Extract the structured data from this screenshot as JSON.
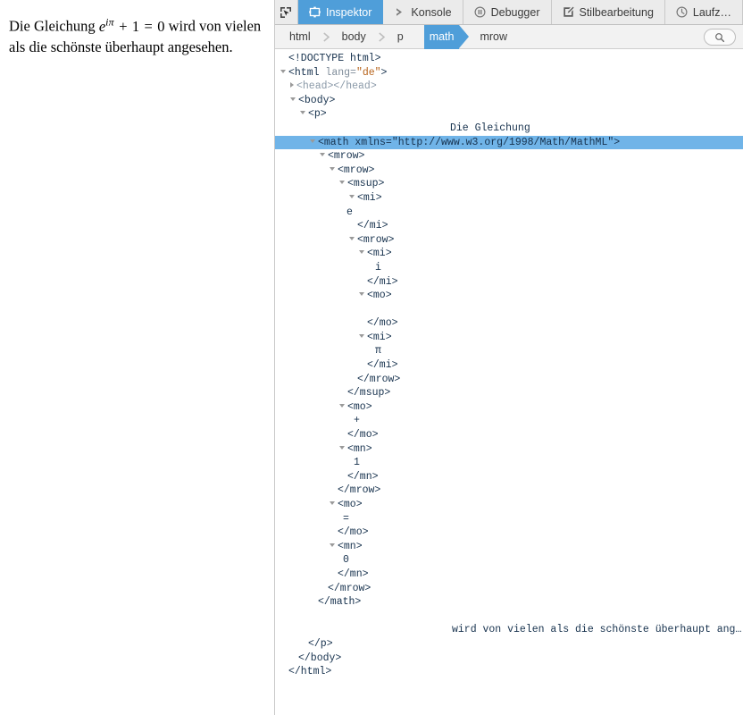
{
  "page": {
    "paragraph_prefix": "Die Gleichung ",
    "math": {
      "base": "e",
      "exponent": "iπ",
      "plus": "+",
      "one": "1",
      "equals": "=",
      "zero": "0"
    },
    "paragraph_suffix": " wird von vielen als die schönste überhaupt angesehen."
  },
  "toolbar": {
    "picker_icon": "node-picker-icon",
    "tabs": [
      {
        "label": "Inspektor",
        "icon": "inspector-icon",
        "active": true
      },
      {
        "label": "Konsole",
        "icon": "console-chevron-icon",
        "active": false
      },
      {
        "label": "Debugger",
        "icon": "debugger-pause-icon",
        "active": false
      },
      {
        "label": "Stilbearbeitung",
        "icon": "style-editor-icon",
        "active": false
      },
      {
        "label": "Laufz…",
        "icon": "performance-clock-icon",
        "active": false
      }
    ],
    "active_tab_color": "#4f9ed9"
  },
  "breadcrumb": {
    "items": [
      {
        "label": "html",
        "selected": false
      },
      {
        "label": "body",
        "selected": false
      },
      {
        "label": "p",
        "selected": false
      },
      {
        "label": "math",
        "selected": true
      },
      {
        "label": "mrow",
        "selected": false
      }
    ],
    "search_icon": "search-icon"
  },
  "markup": {
    "selected_row_color": "#70b4e8",
    "rows": [
      {
        "indent": 0,
        "twisty": "none",
        "type": "doctype",
        "text": "<!DOCTYPE html>"
      },
      {
        "indent": 0,
        "twisty": "open",
        "type": "tag_attr",
        "tag_open": "<html ",
        "attr": "lang=",
        "aval": "\"de\"",
        "tag_close": ">"
      },
      {
        "indent": 1,
        "twisty": "closed",
        "type": "collapsed",
        "text": "<head></head>"
      },
      {
        "indent": 1,
        "twisty": "open",
        "type": "tag",
        "text": "<body>"
      },
      {
        "indent": 2,
        "twisty": "open",
        "type": "tag",
        "text": "<p>"
      },
      {
        "indent": 0,
        "twisty": "none",
        "type": "textnode",
        "text": "Die Gleichung",
        "offset": 196
      },
      {
        "indent": 3,
        "twisty": "open",
        "type": "tag_ns",
        "text": "<math xmlns=\"http://www.w3.org/1998/Math/MathML\">",
        "selected": true
      },
      {
        "indent": 4,
        "twisty": "open",
        "type": "tag",
        "text": "<mrow>"
      },
      {
        "indent": 5,
        "twisty": "open",
        "type": "tag",
        "text": "<mrow>"
      },
      {
        "indent": 6,
        "twisty": "open",
        "type": "tag",
        "text": "<msup>"
      },
      {
        "indent": 7,
        "twisty": "open",
        "type": "tag",
        "text": "<mi>"
      },
      {
        "indent": 0,
        "twisty": "none",
        "type": "textnode",
        "text": "e",
        "offset": 80
      },
      {
        "indent": 7,
        "twisty": "none",
        "type": "tag",
        "text": "</mi>"
      },
      {
        "indent": 7,
        "twisty": "open",
        "type": "tag",
        "text": "<mrow>"
      },
      {
        "indent": 8,
        "twisty": "open",
        "type": "tag",
        "text": "<mi>"
      },
      {
        "indent": 0,
        "twisty": "none",
        "type": "textnode",
        "text": "i",
        "offset": 112
      },
      {
        "indent": 8,
        "twisty": "none",
        "type": "tag",
        "text": "</mi>"
      },
      {
        "indent": 8,
        "twisty": "open",
        "type": "tag",
        "text": "<mo>"
      },
      {
        "indent": 0,
        "twisty": "none",
        "type": "textnode",
        "text": " ",
        "offset": 112
      },
      {
        "indent": 8,
        "twisty": "none",
        "type": "tag",
        "text": "</mo>"
      },
      {
        "indent": 8,
        "twisty": "open",
        "type": "tag",
        "text": "<mi>"
      },
      {
        "indent": 0,
        "twisty": "none",
        "type": "textnode",
        "text": "π",
        "offset": 112
      },
      {
        "indent": 8,
        "twisty": "none",
        "type": "tag",
        "text": "</mi>"
      },
      {
        "indent": 7,
        "twisty": "none",
        "type": "tag",
        "text": "</mrow>"
      },
      {
        "indent": 6,
        "twisty": "none",
        "type": "tag",
        "text": "</msup>"
      },
      {
        "indent": 6,
        "twisty": "open",
        "type": "tag",
        "text": "<mo>"
      },
      {
        "indent": 0,
        "twisty": "none",
        "type": "textnode",
        "text": "+",
        "offset": 88
      },
      {
        "indent": 6,
        "twisty": "none",
        "type": "tag",
        "text": "</mo>"
      },
      {
        "indent": 6,
        "twisty": "open",
        "type": "tag",
        "text": "<mn>"
      },
      {
        "indent": 0,
        "twisty": "none",
        "type": "textnode",
        "text": "1",
        "offset": 88
      },
      {
        "indent": 6,
        "twisty": "none",
        "type": "tag",
        "text": "</mn>"
      },
      {
        "indent": 5,
        "twisty": "none",
        "type": "tag",
        "text": "</mrow>"
      },
      {
        "indent": 5,
        "twisty": "open",
        "type": "tag",
        "text": "<mo>"
      },
      {
        "indent": 0,
        "twisty": "none",
        "type": "textnode",
        "text": "=",
        "offset": 76
      },
      {
        "indent": 5,
        "twisty": "none",
        "type": "tag",
        "text": "</mo>"
      },
      {
        "indent": 5,
        "twisty": "open",
        "type": "tag",
        "text": "<mn>"
      },
      {
        "indent": 0,
        "twisty": "none",
        "type": "textnode",
        "text": "0",
        "offset": 76
      },
      {
        "indent": 5,
        "twisty": "none",
        "type": "tag",
        "text": "</mn>"
      },
      {
        "indent": 4,
        "twisty": "none",
        "type": "tag",
        "text": "</mrow>"
      },
      {
        "indent": 3,
        "twisty": "none",
        "type": "tag",
        "text": "</math>"
      },
      {
        "indent": 0,
        "twisty": "none",
        "type": "blank",
        "text": ""
      },
      {
        "indent": 0,
        "twisty": "none",
        "type": "textnode",
        "text": "wird von vielen als die schönste überhaupt ang…",
        "offset": 198
      },
      {
        "indent": 2,
        "twisty": "none",
        "type": "tag",
        "text": "</p>"
      },
      {
        "indent": 1,
        "twisty": "none",
        "type": "tag",
        "text": "</body>"
      },
      {
        "indent": 0,
        "twisty": "none",
        "type": "tag",
        "text": "</html>"
      }
    ]
  }
}
